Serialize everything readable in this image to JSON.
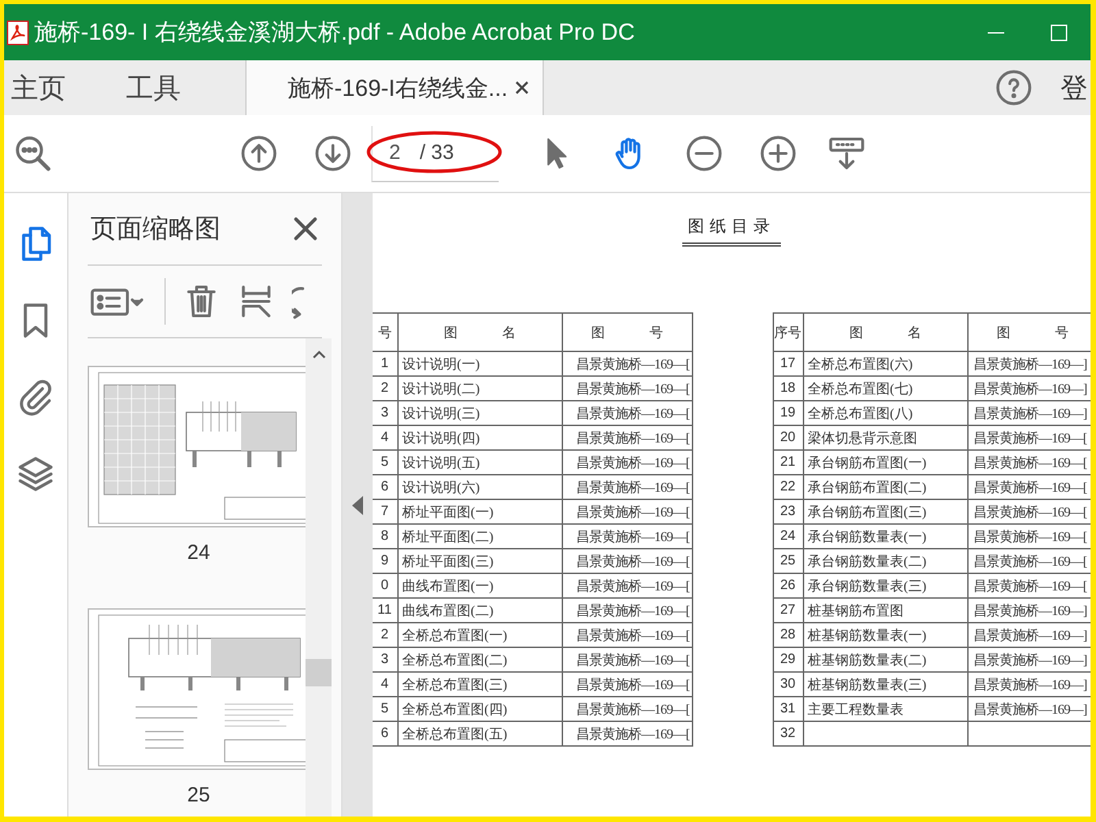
{
  "window": {
    "title": "施桥-169- I 右绕线金溪湖大桥.pdf - Adobe Acrobat Pro DC"
  },
  "nav_tabs": [
    {
      "label": "主页",
      "selected": false
    },
    {
      "label": "工具",
      "selected": false
    }
  ],
  "document_tabs": [
    {
      "label": "施桥-169-I右绕线金...",
      "selected": true
    }
  ],
  "account_label": "登",
  "toolbar": {
    "page_value": "2",
    "page_total": "/ 33",
    "tools": [
      {
        "kind": "select",
        "selected": false
      },
      {
        "kind": "hand",
        "selected": true
      }
    ]
  },
  "sidebar": {
    "rail": [
      {
        "kind": "pages",
        "selected": true
      },
      {
        "kind": "bookmarks",
        "selected": false
      },
      {
        "kind": "attachments",
        "selected": false
      },
      {
        "kind": "layers",
        "selected": false
      }
    ],
    "panel_title": "页面缩略图",
    "thumbnails": [
      {
        "label": "24",
        "kind": "plan"
      },
      {
        "label": "25",
        "kind": "elevation"
      }
    ]
  },
  "document": {
    "title": "图纸目录",
    "tables": [
      {
        "columns": [
          "号",
          "图 名",
          "图 号"
        ],
        "rows": [
          {
            "no": "1",
            "name": "设计说明(一)",
            "code": "昌景黄施桥—169—["
          },
          {
            "no": "2",
            "name": "设计说明(二)",
            "code": "昌景黄施桥—169—["
          },
          {
            "no": "3",
            "name": "设计说明(三)",
            "code": "昌景黄施桥—169—["
          },
          {
            "no": "4",
            "name": "设计说明(四)",
            "code": "昌景黄施桥—169—["
          },
          {
            "no": "5",
            "name": "设计说明(五)",
            "code": "昌景黄施桥—169—["
          },
          {
            "no": "6",
            "name": "设计说明(六)",
            "code": "昌景黄施桥—169—["
          },
          {
            "no": "7",
            "name": "桥址平面图(一)",
            "code": "昌景黄施桥—169—["
          },
          {
            "no": "8",
            "name": "桥址平面图(二)",
            "code": "昌景黄施桥—169—["
          },
          {
            "no": "9",
            "name": "桥址平面图(三)",
            "code": "昌景黄施桥—169—["
          },
          {
            "no": "0",
            "name": "曲线布置图(一)",
            "code": "昌景黄施桥—169—["
          },
          {
            "no": "11",
            "name": "曲线布置图(二)",
            "code": "昌景黄施桥—169—["
          },
          {
            "no": "2",
            "name": "全桥总布置图(一)",
            "code": "昌景黄施桥—169—["
          },
          {
            "no": "3",
            "name": "全桥总布置图(二)",
            "code": "昌景黄施桥—169—["
          },
          {
            "no": "4",
            "name": "全桥总布置图(三)",
            "code": "昌景黄施桥—169—["
          },
          {
            "no": "5",
            "name": "全桥总布置图(四)",
            "code": "昌景黄施桥—169—["
          },
          {
            "no": "6",
            "name": "全桥总布置图(五)",
            "code": "昌景黄施桥—169—["
          }
        ]
      },
      {
        "columns": [
          "序号",
          "图 名",
          "图 号"
        ],
        "rows": [
          {
            "no": "17",
            "name": "全桥总布置图(六)",
            "code": "昌景黄施桥—169—]"
          },
          {
            "no": "18",
            "name": "全桥总布置图(七)",
            "code": "昌景黄施桥—169—]"
          },
          {
            "no": "19",
            "name": "全桥总布置图(八)",
            "code": "昌景黄施桥—169—]"
          },
          {
            "no": "20",
            "name": "梁体切悬背示意图",
            "code": "昌景黄施桥—169—["
          },
          {
            "no": "21",
            "name": "承台钢筋布置图(一)",
            "code": "昌景黄施桥—169—["
          },
          {
            "no": "22",
            "name": "承台钢筋布置图(二)",
            "code": "昌景黄施桥—169—["
          },
          {
            "no": "23",
            "name": "承台钢筋布置图(三)",
            "code": "昌景黄施桥—169—["
          },
          {
            "no": "24",
            "name": "承台钢筋数量表(一)",
            "code": "昌景黄施桥—169—["
          },
          {
            "no": "25",
            "name": "承台钢筋数量表(二)",
            "code": "昌景黄施桥—169—["
          },
          {
            "no": "26",
            "name": "承台钢筋数量表(三)",
            "code": "昌景黄施桥—169—["
          },
          {
            "no": "27",
            "name": "桩基钢筋布置图",
            "code": "昌景黄施桥—169—]"
          },
          {
            "no": "28",
            "name": "桩基钢筋数量表(一)",
            "code": "昌景黄施桥—169—]"
          },
          {
            "no": "29",
            "name": "桩基钢筋数量表(二)",
            "code": "昌景黄施桥—169—]"
          },
          {
            "no": "30",
            "name": "桩基钢筋数量表(三)",
            "code": "昌景黄施桥—169—]"
          },
          {
            "no": "31",
            "name": "主要工程数量表",
            "code": "昌景黄施桥—169—]"
          },
          {
            "no": "32"
          }
        ]
      }
    ]
  }
}
